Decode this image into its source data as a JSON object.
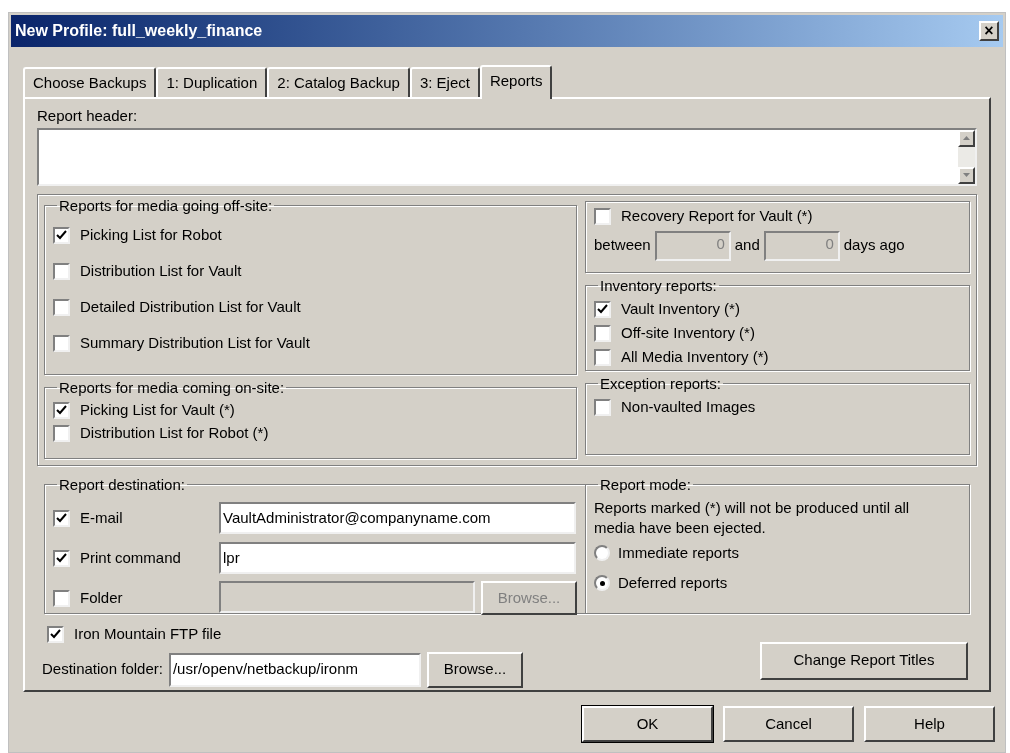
{
  "window": {
    "title": "New Profile: full_weekly_finance",
    "close": "×"
  },
  "tabs": [
    {
      "label": "Choose Backups",
      "selected": false
    },
    {
      "label": "1: Duplication",
      "selected": false
    },
    {
      "label": "2: Catalog Backup",
      "selected": false
    },
    {
      "label": "3: Eject",
      "selected": false
    },
    {
      "label": "Reports",
      "selected": true
    }
  ],
  "report_header": {
    "label": "Report header:"
  },
  "offsite": {
    "title": "Reports for media going off-site:",
    "items": [
      {
        "label": "Picking List for Robot",
        "checked": true
      },
      {
        "label": "Distribution List for Vault",
        "checked": false
      },
      {
        "label": "Detailed Distribution List for Vault",
        "checked": false
      },
      {
        "label": "Summary Distribution List for Vault",
        "checked": false
      }
    ]
  },
  "onsite": {
    "title": "Reports for media coming on-site:",
    "items": [
      {
        "label": "Picking List for Vault (*)",
        "checked": true
      },
      {
        "label": "Distribution List for Robot (*)",
        "checked": false
      }
    ]
  },
  "recovery": {
    "label": "Recovery Report for Vault (*)",
    "checked": false,
    "between": "between",
    "from": "0",
    "and": "and",
    "to": "0",
    "suffix": "days ago",
    "disabled": true
  },
  "inventory": {
    "title": "Inventory reports:",
    "items": [
      {
        "label": "Vault Inventory (*)",
        "checked": true
      },
      {
        "label": "Off-site Inventory (*)",
        "checked": false
      },
      {
        "label": "All Media Inventory (*)",
        "checked": false
      }
    ]
  },
  "exception": {
    "title": "Exception reports:",
    "items": [
      {
        "label": "Non-vaulted Images",
        "checked": false
      }
    ]
  },
  "destination": {
    "title": "Report destination:",
    "rows": [
      {
        "label": "E-mail",
        "checked": true,
        "value": "VaultAdministrator@companyname.com",
        "disabled": false
      },
      {
        "label": "Print command",
        "checked": true,
        "value": "lpr",
        "disabled": false
      },
      {
        "label": "Folder",
        "checked": false,
        "disabled": true,
        "button": "Browse..."
      }
    ]
  },
  "report_mode": {
    "title": "Report mode:",
    "note": "Reports marked (*) will not be produced until all media have been ejected.",
    "options": [
      {
        "label": "Immediate reports",
        "selected": false
      },
      {
        "label": "Deferred reports",
        "selected": true
      }
    ]
  },
  "ftp": {
    "label": "Iron Mountain FTP file",
    "checked": true
  },
  "destination_folder": {
    "label": "Destination folder:",
    "value": "/usr/openv/netbackup/ironm",
    "button": "Browse..."
  },
  "change_titles": "Change Report Titles",
  "buttons": [
    {
      "label": "OK",
      "default": true
    },
    {
      "label": "Cancel",
      "default": false
    },
    {
      "label": "Help",
      "default": false
    }
  ]
}
